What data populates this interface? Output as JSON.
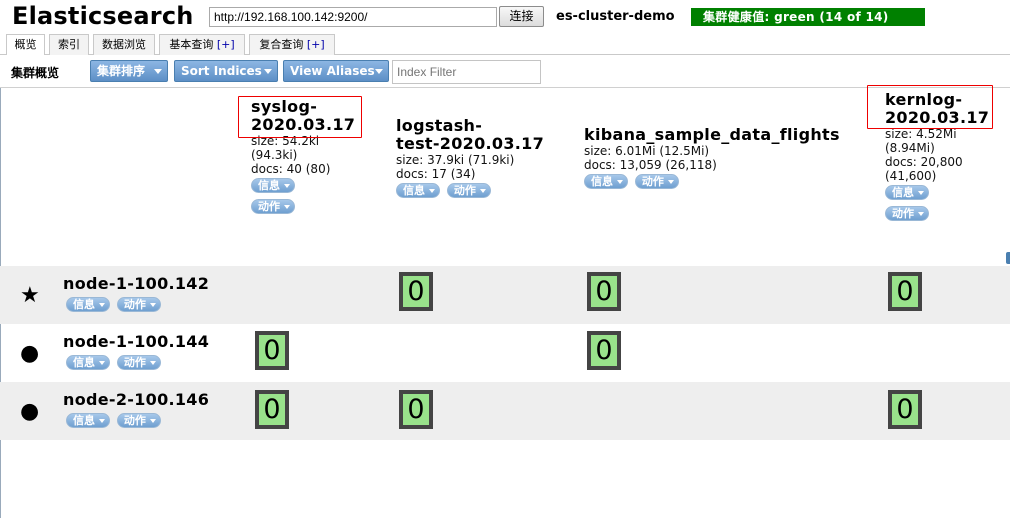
{
  "app": {
    "logo": "Elasticsearch",
    "url": "http://192.168.100.142:9200/",
    "connect_label": "连接",
    "cluster_name": "es-cluster-demo",
    "health": "集群健康值: green (14 of 14)"
  },
  "tabs": [
    {
      "label": "概览",
      "plus": ""
    },
    {
      "label": "索引",
      "plus": ""
    },
    {
      "label": "数据浏览",
      "plus": ""
    },
    {
      "label": "基本查询",
      "plus": "[+]"
    },
    {
      "label": "复合查询",
      "plus": "[+]"
    }
  ],
  "toolbar": {
    "title": "集群概览",
    "sort_cluster": "集群排序",
    "sort_indices": "Sort Indices",
    "view_aliases": "View Aliases",
    "filter_placeholder": "Index Filter"
  },
  "indices": [
    {
      "name_line1": "syslog-",
      "name_line2": "2020.03.17",
      "size_line1": "size: 54.2ki",
      "size_line2": "(94.3ki)",
      "docs": "docs: 40 (80)",
      "info": "信息",
      "action": "动作"
    },
    {
      "name_line1": "logstash-",
      "name_line2": "test-2020.03.17",
      "size_line1": "size: 37.9ki (71.9ki)",
      "docs": "docs: 17 (34)",
      "info": "信息",
      "action": "动作"
    },
    {
      "name_line1": "kibana_sample_data_flights",
      "size_line1": "size: 6.01Mi (12.5Mi)",
      "docs": "docs: 13,059 (26,118)",
      "info": "信息",
      "action": "动作"
    },
    {
      "name_line1": "kernlog-",
      "name_line2": "2020.03.17",
      "size_line1": "size: 4.52Mi",
      "size_line2": "(8.94Mi)",
      "docs": "docs: 20,800",
      "docs_line2": "(41,600)",
      "info": "信息",
      "action": "动作"
    }
  ],
  "nodes": [
    {
      "name": "node-1-100.142",
      "icon": "star-icon",
      "glyph": "★",
      "info": "信息",
      "action": "动作",
      "shards": [
        "0",
        "0",
        "0"
      ]
    },
    {
      "name": "node-1-100.144",
      "icon": "circle-icon",
      "glyph": "●",
      "info": "信息",
      "action": "动作",
      "shards": [
        "0",
        "0"
      ]
    },
    {
      "name": "node-2-100.146",
      "icon": "circle-icon",
      "glyph": "●",
      "info": "信息",
      "action": "动作",
      "shards": [
        "0",
        "0",
        "0"
      ]
    }
  ],
  "colors": {
    "health_green": "#008000",
    "shard_green": "#99e28b",
    "highlight_red": "#e00000",
    "button_blue": "#5d8fc6"
  }
}
